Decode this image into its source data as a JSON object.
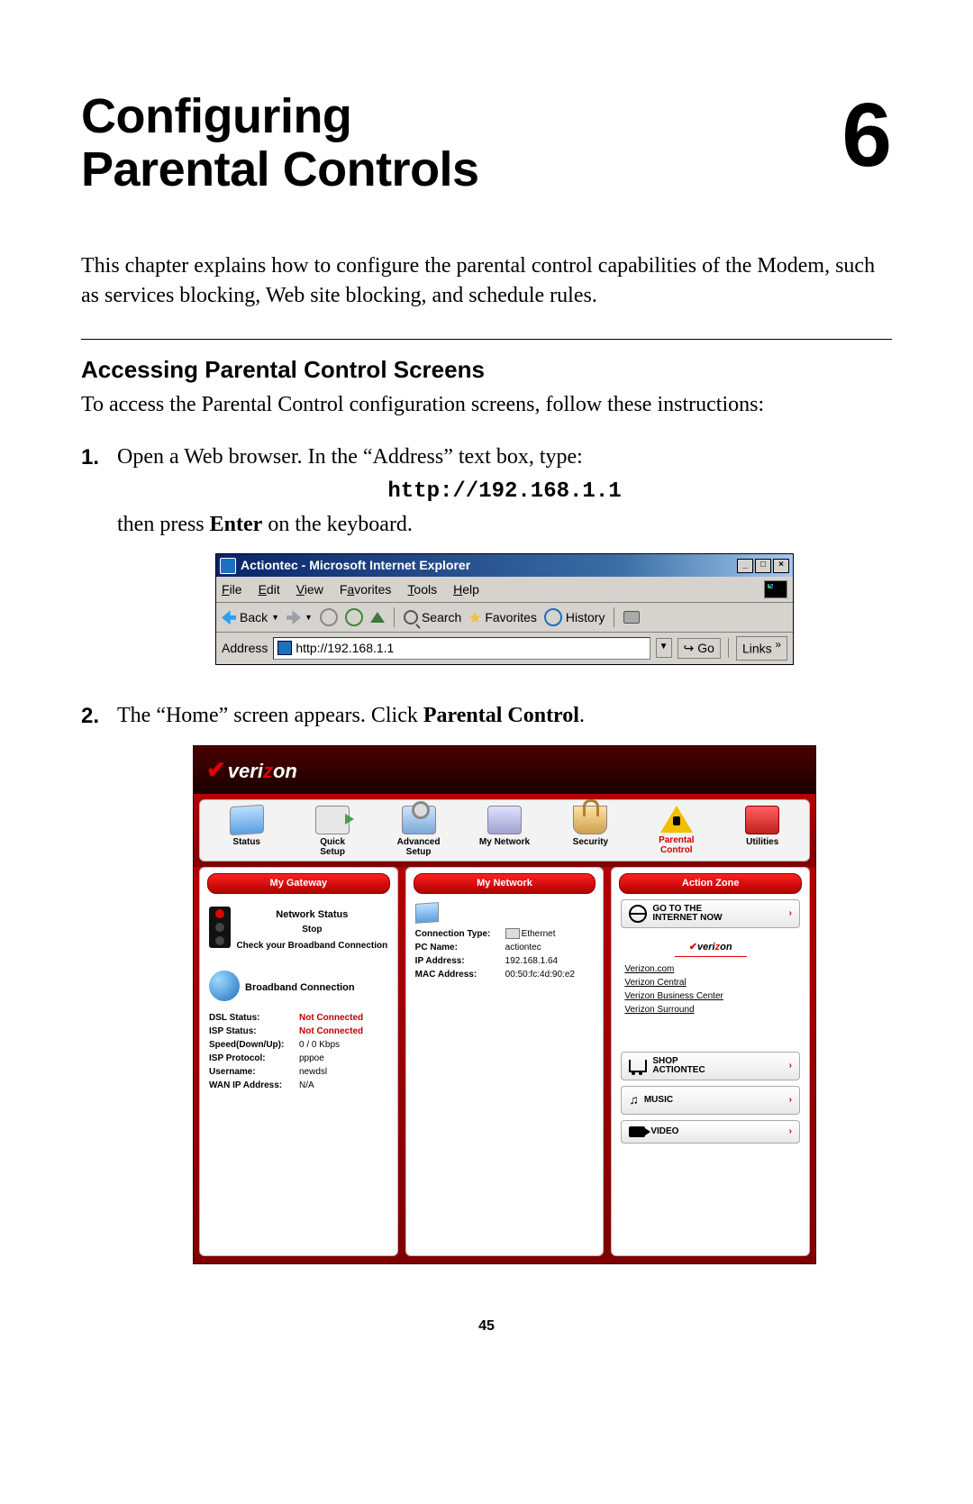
{
  "chapter": {
    "title_line1": "Configuring",
    "title_line2": "Parental Controls",
    "number": "6"
  },
  "intro": "This chapter explains how to configure the parental control capabilities of the Modem, such as services blocking, Web site blocking, and schedule rules.",
  "section": {
    "title": "Accessing Parental Control Screens",
    "intro": "To access the Parental Control configuration screens, follow these instructions:"
  },
  "steps": {
    "s1_num": "1.",
    "s1_a": "Open a Web browser. In the “Address” text box, type:",
    "s1_url": "http://192.168.1.1",
    "s1_b_pre": "then press ",
    "s1_b_bold": "Enter",
    "s1_b_post": " on the keyboard.",
    "s2_num": "2.",
    "s2_a": "The “Home” screen appears. Click ",
    "s2_bold": "Parental Control",
    "s2_post": "."
  },
  "ie": {
    "title": "Actiontec - Microsoft Internet Explorer",
    "menu": {
      "file": "File",
      "edit": "Edit",
      "view": "View",
      "fav": "Favorites",
      "tools": "Tools",
      "help": "Help"
    },
    "toolbar": {
      "back": "Back",
      "search": "Search",
      "favorites": "Favorites",
      "history": "History"
    },
    "address_label": "Address",
    "address_value": "http://192.168.1.1",
    "go": "Go",
    "links": "Links"
  },
  "vz": {
    "logo": "verizon",
    "nav": {
      "status": "Status",
      "quick": "Quick\nSetup",
      "advanced": "Advanced\nSetup",
      "network": "My Network",
      "security": "Security",
      "parental": "Parental\nControl",
      "utilities": "Utilities"
    },
    "panels": {
      "gateway": "My Gateway",
      "network": "My Network",
      "action": "Action Zone"
    },
    "gateway": {
      "status_head": "Network Status",
      "stop": "Stop",
      "check": "Check your Broadband Connection",
      "bb_head": "Broadband Connection",
      "dsl_k": "DSL Status:",
      "dsl_v": "Not Connected",
      "isp_k": "ISP Status:",
      "isp_v": "Not Connected",
      "speed_k": "Speed(Down/Up):",
      "speed_v": "0 / 0 Kbps",
      "proto_k": "ISP Protocol:",
      "proto_v": "pppoe",
      "user_k": "Username:",
      "user_v": "newdsl",
      "wan_k": "WAN IP Address:",
      "wan_v": "N/A"
    },
    "network": {
      "conn_type_k": "Connection Type:",
      "conn_type_v": "Ethernet",
      "pc_k": "PC Name:",
      "pc_v": "actiontec",
      "ip_k": "IP Address:",
      "ip_v": "192.168.1.64",
      "mac_k": "MAC Address:",
      "mac_v": "00:50:fc:4d:90:e2"
    },
    "action": {
      "btn_internet": "GO TO THE\nINTERNET NOW",
      "links": {
        "l1": "Verizon.com",
        "l2": "Verizon Central",
        "l3": "Verizon Business Center",
        "l4": "Verizon Surround"
      },
      "btn_shop": "SHOP\nACTIONTEC",
      "btn_music": "MUSIC",
      "btn_video": "VIDEO"
    }
  },
  "page_number": "45"
}
